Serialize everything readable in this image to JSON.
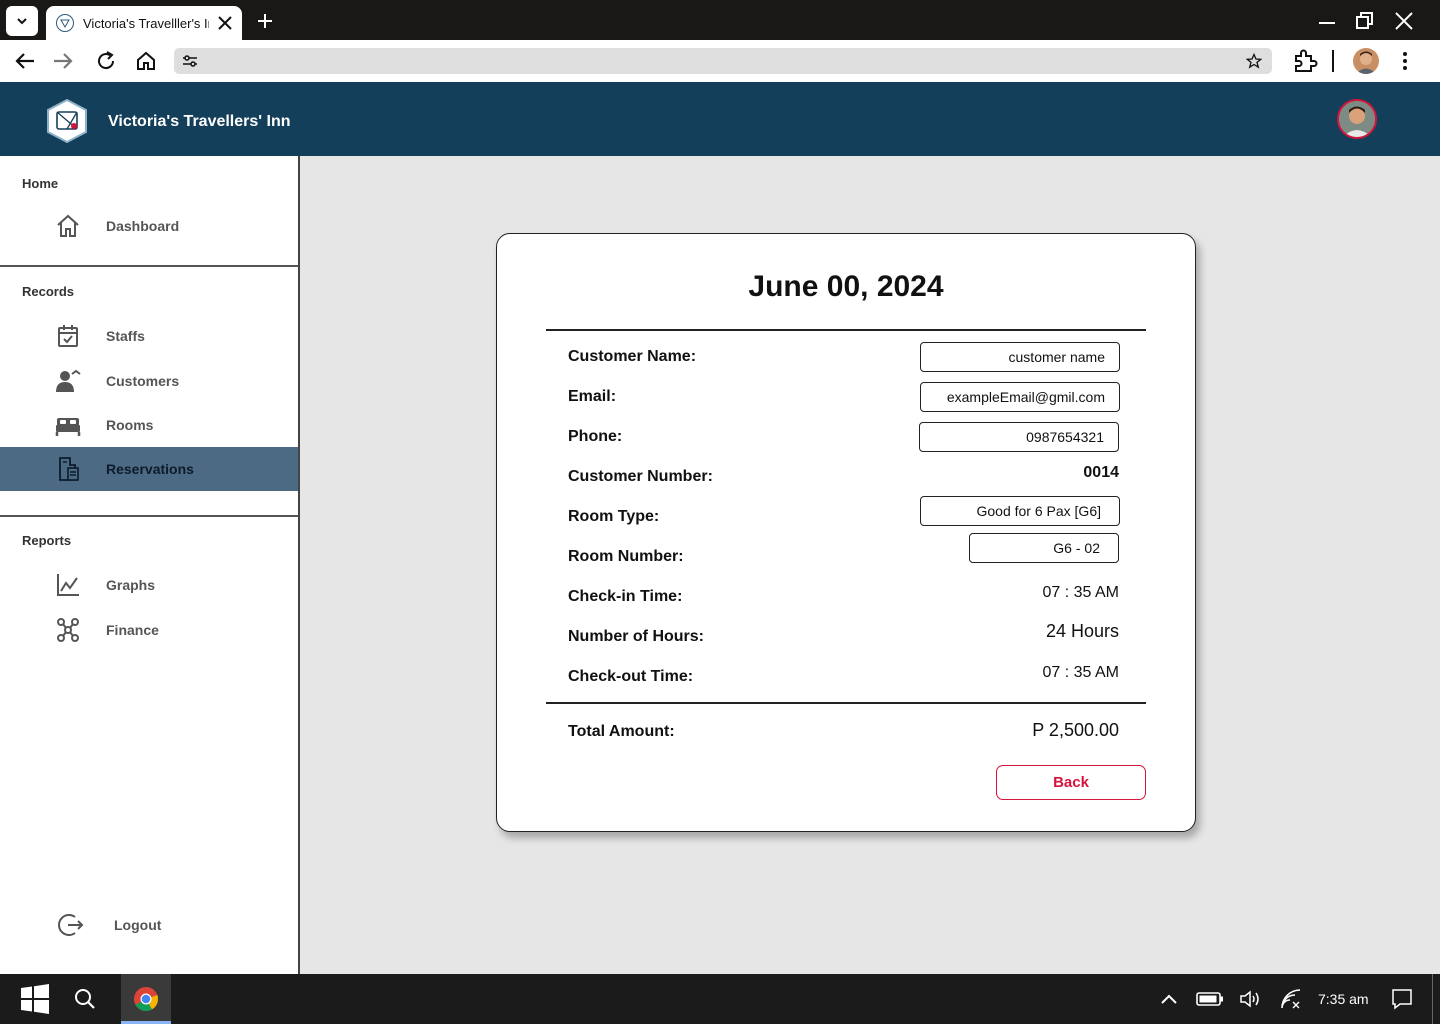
{
  "browser": {
    "tab_title": "Victoria's Travelller's Inn",
    "url": ""
  },
  "header": {
    "app_title": "Victoria's Travellers' Inn"
  },
  "sidebar": {
    "sections": {
      "home": "Home",
      "records": "Records",
      "reports": "Reports"
    },
    "items": {
      "dashboard": "Dashboard",
      "staffs": "Staffs",
      "customers": "Customers",
      "rooms": "Rooms",
      "reservations": "Reservations",
      "graphs": "Graphs",
      "finance": "Finance",
      "logout": "Logout"
    },
    "active": "reservations"
  },
  "reservation": {
    "date": "June 00, 2024",
    "labels": {
      "customer_name": "Customer Name:",
      "email": "Email:",
      "phone": "Phone:",
      "customer_number": "Customer Number:",
      "room_type": "Room Type:",
      "room_number": "Room Number:",
      "check_in": "Check-in Time:",
      "hours": "Number of Hours:",
      "check_out": "Check-out Time:",
      "total": "Total Amount:"
    },
    "values": {
      "customer_name": "customer name",
      "email": "exampleEmail@gmil.com",
      "phone": "0987654321",
      "customer_number": "0014",
      "room_type": "Good for 6 Pax [G6]",
      "room_number": "G6 - 02",
      "check_in": "07 : 35 AM",
      "hours": "24 Hours",
      "check_out": "07 : 35 AM",
      "total": "P 2,500.00"
    },
    "back_label": "Back"
  },
  "taskbar": {
    "time": "7:35 am"
  },
  "colors": {
    "header_bg": "#133f5a",
    "sidebar_active": "#4d6a84",
    "accent_red": "#d6133c"
  }
}
